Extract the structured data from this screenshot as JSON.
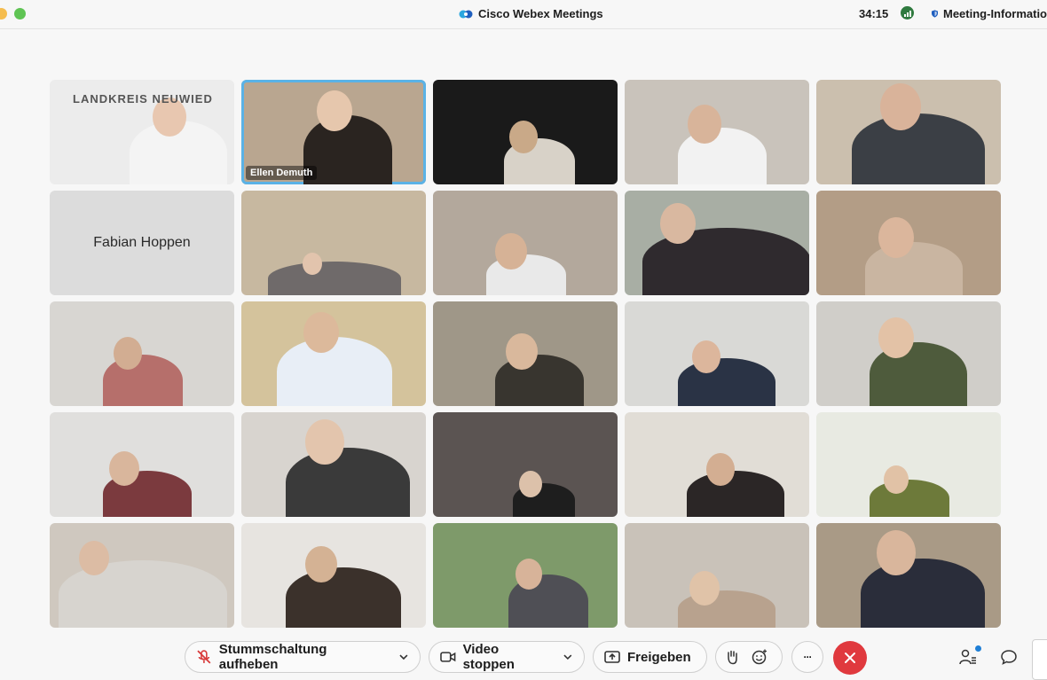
{
  "window": {
    "title": "Cisco Webex Meetings",
    "timer": "34:15",
    "meeting_info": "Meeting-Informatio"
  },
  "participants": [
    {
      "label": "",
      "banner": "LANDKREIS NEUWIED",
      "bg": "#ececec"
    },
    {
      "label": "Ellen Demuth",
      "active": true,
      "bg": "#b9a690"
    },
    {
      "label": "",
      "bg": "#1a1a1a"
    },
    {
      "label": "",
      "bg": "#c9c3bb"
    },
    {
      "label": "",
      "bg": "#cbbfae"
    },
    {
      "label": "",
      "name_only": "Fabian Hoppen",
      "bg": "#dcdcdc"
    },
    {
      "label": "",
      "bg": "#c7b8a0"
    },
    {
      "label": "",
      "bg": "#b3a89c"
    },
    {
      "label": "",
      "bg": "#a8aea4"
    },
    {
      "label": "",
      "bg": "#b39d86"
    },
    {
      "label": "",
      "bg": "#d8d6d2"
    },
    {
      "label": "",
      "bg": "#d4c39c"
    },
    {
      "label": "",
      "bg": "#9f9788"
    },
    {
      "label": "",
      "bg": "#d9d9d6"
    },
    {
      "label": "",
      "bg": "#d0cec9"
    },
    {
      "label": "",
      "bg": "#e0dfdd"
    },
    {
      "label": "",
      "bg": "#d8d4cf"
    },
    {
      "label": "",
      "bg": "#5b5452"
    },
    {
      "label": "",
      "bg": "#e1ddd6"
    },
    {
      "label": "",
      "bg": "#e8eae2"
    },
    {
      "label": "",
      "bg": "#cfc8bf"
    },
    {
      "label": "",
      "bg": "#e7e4e0"
    },
    {
      "label": "",
      "bg": "#7e9a6a"
    },
    {
      "label": "",
      "bg": "#c9c2b9"
    },
    {
      "label": "",
      "bg": "#a99a86"
    }
  ],
  "toolbar": {
    "mute_label": "Stummschaltung aufheben",
    "video_label": "Video stoppen",
    "share_label": "Freigeben",
    "more_label": "···"
  },
  "colors": {
    "end_call": "#e0393e",
    "active_speaker_border": "#5ab2e6"
  }
}
